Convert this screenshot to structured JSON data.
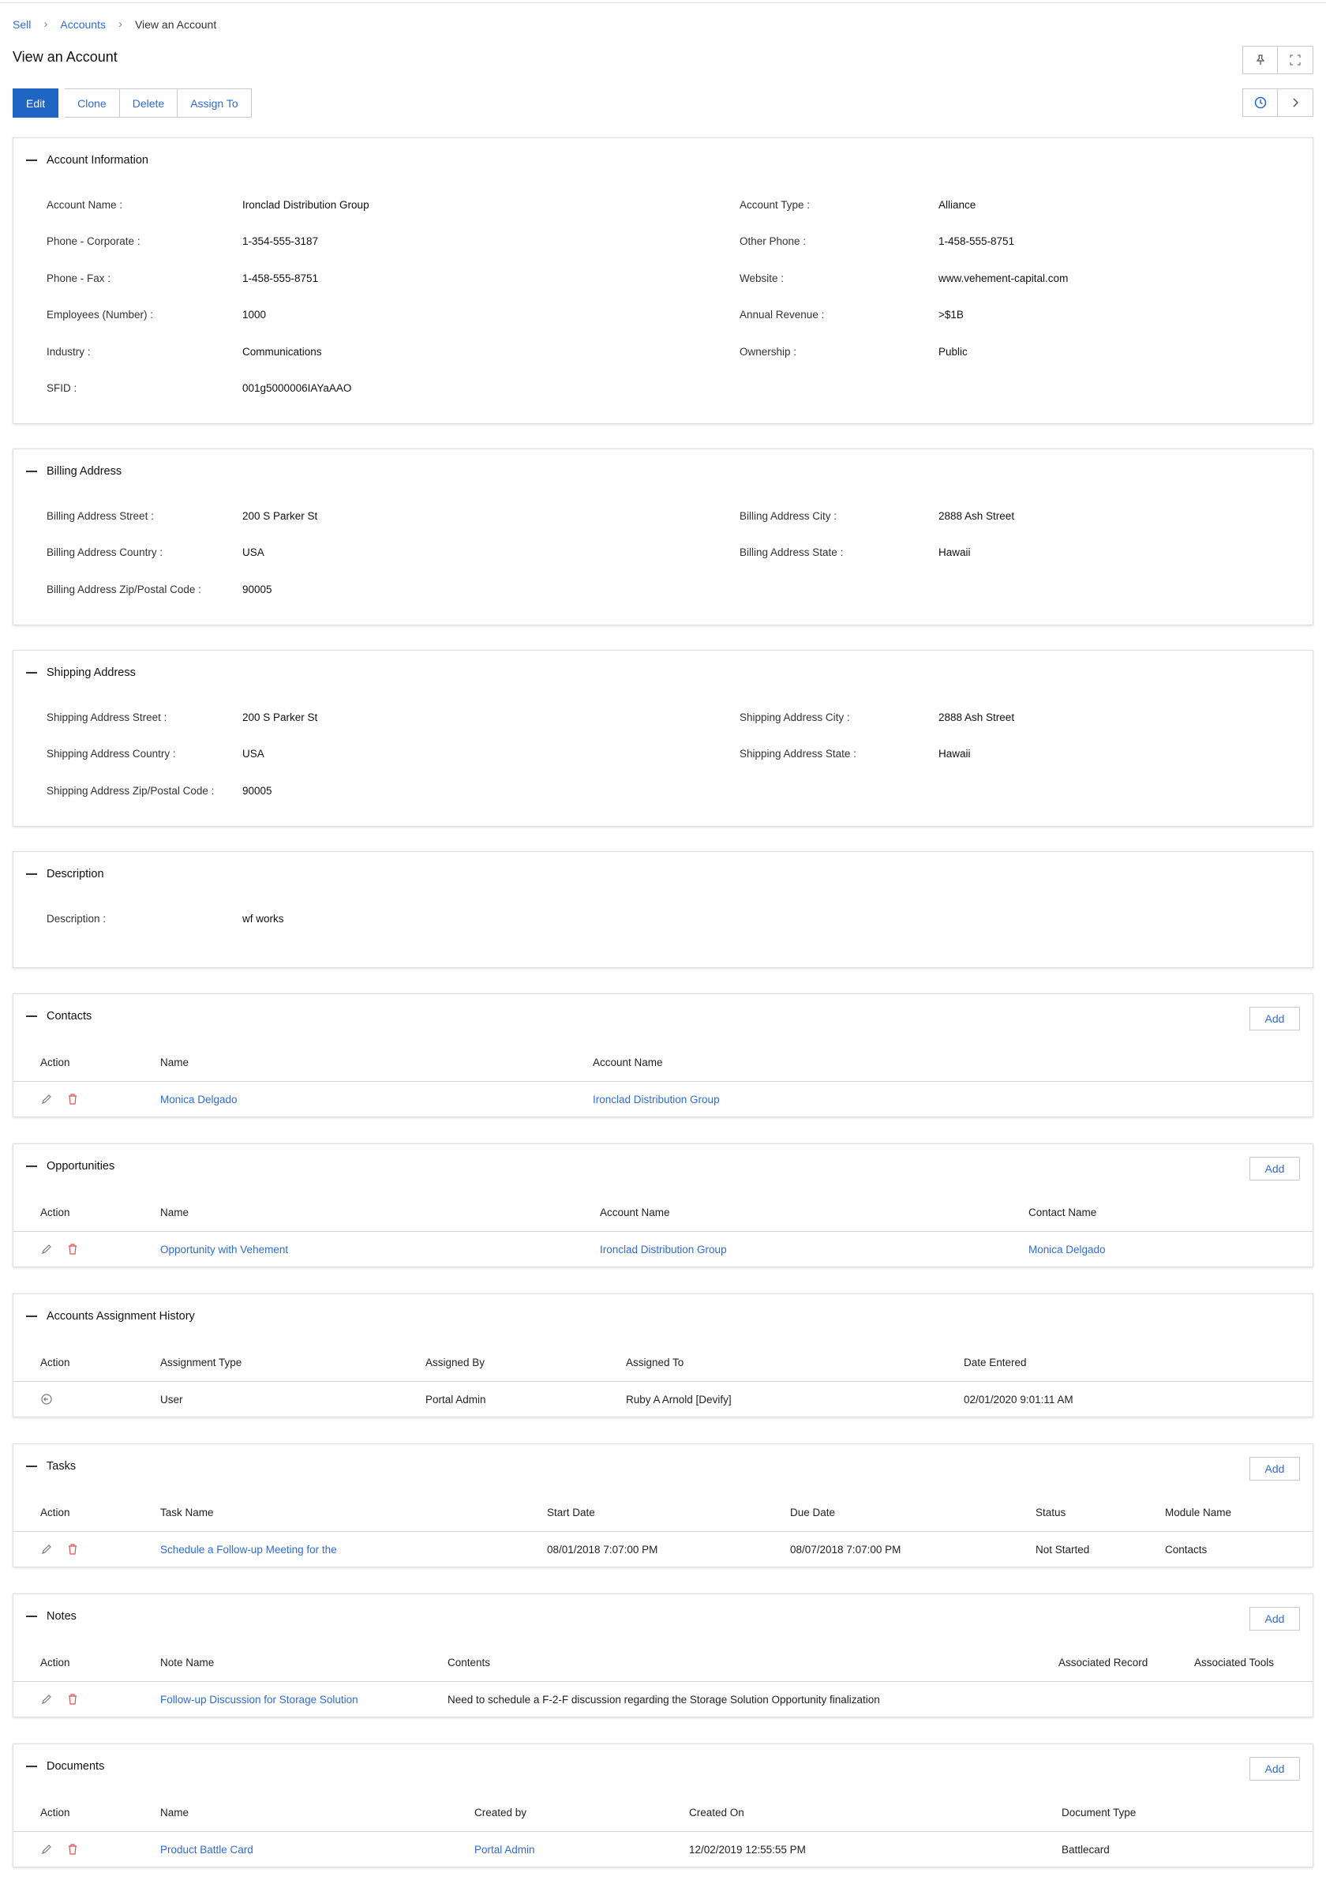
{
  "breadcrumb": [
    "Sell",
    "Accounts",
    "View an Account"
  ],
  "page_title": "View an Account",
  "toolbar": {
    "edit": "Edit",
    "clone": "Clone",
    "delete": "Delete",
    "assign_to": "Assign To"
  },
  "icons": {
    "pin": "pin-icon",
    "fullscreen": "fullscreen-icon",
    "history": "history-icon",
    "next": "chevron-right-icon"
  },
  "colors": {
    "primary": "#1f66c4",
    "link": "#2f6bd6",
    "delete_icon": "#e05252"
  },
  "account_info": {
    "title": "Account Information",
    "left": [
      {
        "k": "Account Name :",
        "v": "Ironclad Distribution Group"
      },
      {
        "k": "Phone - Corporate :",
        "v": "1-354-555-3187"
      },
      {
        "k": "Phone - Fax :",
        "v": "1-458-555-8751"
      },
      {
        "k": "Employees (Number) :",
        "v": "1000"
      },
      {
        "k": "Industry :",
        "v": "Communications"
      },
      {
        "k": "SFID :",
        "v": "001g5000006IAYaAAO"
      }
    ],
    "right": [
      {
        "k": "Account Type :",
        "v": "Alliance"
      },
      {
        "k": "Other Phone :",
        "v": "1-458-555-8751"
      },
      {
        "k": "Website :",
        "v": "www.vehement-capital.com"
      },
      {
        "k": "Annual Revenue :",
        "v": ">$1B"
      },
      {
        "k": "Ownership :",
        "v": "Public"
      }
    ]
  },
  "billing": {
    "title": "Billing Address",
    "left": [
      {
        "k": "Billing Address Street :",
        "v": "200 S Parker St"
      },
      {
        "k": "Billing Address Country :",
        "v": "USA"
      },
      {
        "k": "Billing Address Zip/Postal Code :",
        "v": "90005"
      }
    ],
    "right": [
      {
        "k": "Billing Address City :",
        "v": "2888 Ash Street"
      },
      {
        "k": "Billing Address State :",
        "v": "Hawaii"
      }
    ]
  },
  "shipping": {
    "title": "Shipping Address",
    "left": [
      {
        "k": "Shipping Address Street :",
        "v": "200 S Parker St"
      },
      {
        "k": "Shipping Address Country :",
        "v": "USA"
      },
      {
        "k": "Shipping Address Zip/Postal Code :",
        "v": "90005"
      }
    ],
    "right": [
      {
        "k": "Shipping Address City :",
        "v": "2888 Ash Street"
      },
      {
        "k": "Shipping Address State :",
        "v": "Hawaii"
      }
    ]
  },
  "description": {
    "title": "Description",
    "left": [
      {
        "k": "Description :",
        "v": "wf works"
      }
    ]
  },
  "add_label": "Add",
  "contacts": {
    "title": "Contacts",
    "headers": [
      "Action",
      "Name",
      "Account Name"
    ],
    "rows": [
      {
        "name": "Monica Delgado",
        "account": "Ironclad Distribution Group"
      }
    ]
  },
  "opportunities": {
    "title": "Opportunities",
    "headers": [
      "Action",
      "Name",
      "Account Name",
      "Contact Name"
    ],
    "rows": [
      {
        "name": "Opportunity with Vehement",
        "account": "Ironclad Distribution Group",
        "contact": "Monica Delgado"
      }
    ]
  },
  "assignment": {
    "title": "Accounts Assignment History",
    "headers": [
      "Action",
      "Assignment Type",
      "Assigned By",
      "Assigned To",
      "Date Entered"
    ],
    "rows": [
      {
        "type": "User",
        "by": "Portal Admin",
        "to": "Ruby A Arnold [Devify]",
        "date": "02/01/2020 9:01:11 AM"
      }
    ]
  },
  "tasks": {
    "title": "Tasks",
    "headers": [
      "Action",
      "Task Name",
      "Start Date",
      "Due Date",
      "Status",
      "Module Name"
    ],
    "rows": [
      {
        "name": "Schedule a Follow-up Meeting for the",
        "start": "08/01/2018 7:07:00 PM",
        "due": "08/07/2018 7:07:00 PM",
        "status": "Not Started",
        "module": "Contacts"
      }
    ]
  },
  "notes": {
    "title": "Notes",
    "headers": [
      "Action",
      "Note Name",
      "Contents",
      "Associated Record",
      "Associated Tools"
    ],
    "rows": [
      {
        "name": "Follow-up Discussion for Storage Solution",
        "contents": "Need to schedule a F-2-F discussion regarding the Storage Solution Opportunity finalization"
      }
    ]
  },
  "documents": {
    "title": "Documents",
    "headers": [
      "Action",
      "Name",
      "Created by",
      "Created On",
      "Document Type"
    ],
    "rows": [
      {
        "name": "Product Battle Card",
        "created_by": "Portal Admin",
        "created_on": "12/02/2019 12:55:55 PM",
        "type": "Battlecard"
      }
    ]
  }
}
